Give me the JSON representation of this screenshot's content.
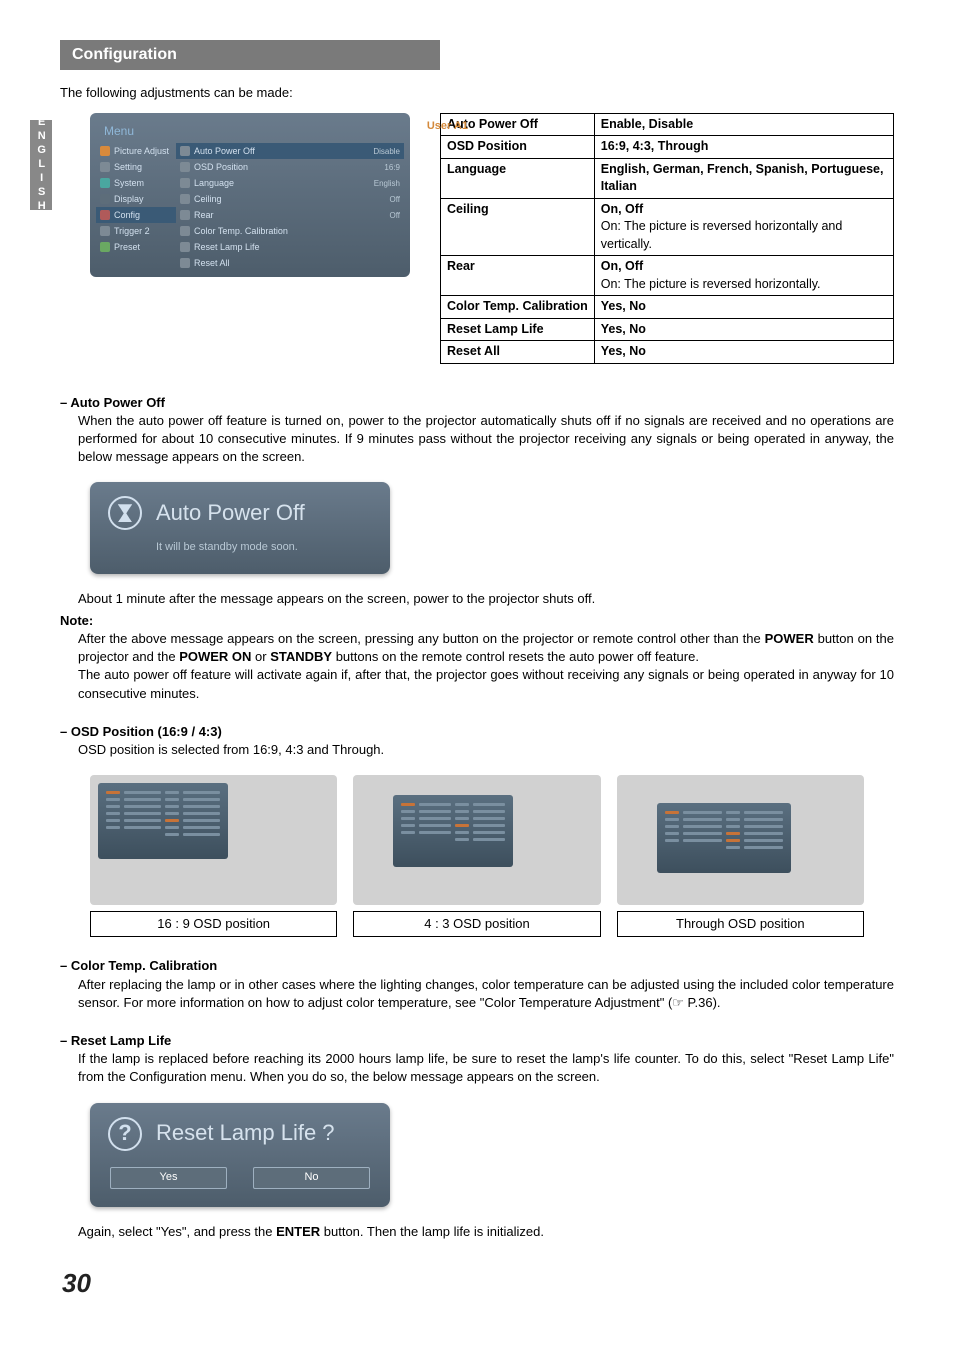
{
  "side_tab": "ENGLISH",
  "section_title": "Configuration",
  "intro": "The following adjustments can be made:",
  "menu": {
    "title": "Menu",
    "user_badge": "User A1",
    "left": [
      "Picture Adjust",
      "Setting",
      "System",
      "Display",
      "Config",
      "Trigger 2",
      "Preset"
    ],
    "right": [
      {
        "label": "Auto Power Off",
        "value": "Disable"
      },
      {
        "label": "OSD Position",
        "value": "16:9"
      },
      {
        "label": "Language",
        "value": "English"
      },
      {
        "label": "Ceiling",
        "value": "Off"
      },
      {
        "label": "Rear",
        "value": "Off"
      },
      {
        "label": "Color Temp. Calibration",
        "value": ""
      },
      {
        "label": "Reset Lamp Life",
        "value": ""
      },
      {
        "label": "Reset All",
        "value": ""
      }
    ]
  },
  "settings": [
    {
      "k": "Auto Power Off",
      "v": "<b>Enable, Disable</b>"
    },
    {
      "k": "OSD Position",
      "v": "<b>16:9, 4:3, Through</b>"
    },
    {
      "k": "Language",
      "v": "<b>English, German, French, Spanish, Portuguese, Italian</b>"
    },
    {
      "k": "Ceiling",
      "v": "<b>On, Off</b><br>On: The picture is reversed horizontally and vertically."
    },
    {
      "k": "Rear",
      "v": "<b>On, Off</b><br>On: The picture is reversed horizontally."
    },
    {
      "k": "Color Temp. Calibration",
      "v": "<b>Yes, No</b>"
    },
    {
      "k": "Reset Lamp Life",
      "v": "<b>Yes, No</b>"
    },
    {
      "k": "Reset All",
      "v": "<b>Yes, No</b>"
    }
  ],
  "auto_power_off": {
    "head": "– Auto Power Off",
    "p1": "When the auto power off feature is turned on, power to the projector automatically shuts off if no signals are received and no operations are performed for about 10 consecutive minutes. If 9 minutes pass without the projector receiving any signals or being operated in anyway, the below message appears on the screen.",
    "callout_title": "Auto Power Off",
    "callout_sub": "It will be standby mode soon.",
    "after": "About 1 minute after the message appears on the screen, power to the projector shuts off.",
    "note_label": "Note:",
    "note1_a": "After the above message appears on the screen, pressing any button on the projector or remote control other than the ",
    "note1_power": "POWER",
    "note1_b": " button on the projector and the ",
    "note1_poweron": "POWER ON",
    "note1_c": " or ",
    "note1_standby": "STANDBY",
    "note1_d": " buttons on the remote control resets the auto power off feature.",
    "note2": "The auto power off feature will activate again if, after that, the projector goes without receiving any signals or being operated in anyway for 10 consecutive minutes."
  },
  "osd": {
    "head": "– OSD Position (16:9 / 4:3)",
    "p": "OSD position is selected from 16:9, 4:3 and Through.",
    "labels": [
      "16 : 9  OSD position",
      "4 : 3  OSD position",
      "Through  OSD position"
    ]
  },
  "color_temp": {
    "head": "– Color Temp. Calibration",
    "p": "After replacing the lamp or in other cases where the lighting changes, color temperature can be adjusted using the included color temperature sensor. For more information on how to adjust color temperature, see \"Color Temperature Adjustment\" (☞ P.36)."
  },
  "reset_lamp": {
    "head": "– Reset Lamp Life",
    "p": "If the lamp is replaced before reaching its 2000 hours lamp life, be sure to reset the lamp's life counter. To do this, select \"Reset Lamp Life\" from the Configuration menu. When you do so, the below message appears on the screen.",
    "callout_title": "Reset Lamp Life ?",
    "yes": "Yes",
    "no": "No",
    "after_a": "Again, select \"Yes\", and press the ",
    "after_enter": "ENTER",
    "after_b": " button. Then the lamp life is initialized."
  },
  "page_number": "30"
}
